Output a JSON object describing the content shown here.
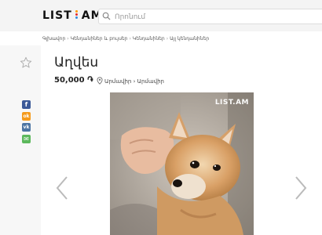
{
  "header": {
    "logo_text_left": "LIST",
    "logo_text_right": "AM",
    "search_placeholder": "Որոնում"
  },
  "breadcrumb": [
    "Գլխավոր",
    "Կենդանիներ և բույսեր",
    "Կենդանիներ",
    "Այլ կենդանիներ"
  ],
  "listing": {
    "title": "Աղվես",
    "price": "50,000 ֏",
    "location": "Արմավիր › Արմավիր"
  },
  "photo": {
    "watermark": "LIST.AM"
  },
  "social": [
    {
      "name": "facebook",
      "glyph": "f",
      "color": "#3b5998"
    },
    {
      "name": "odnoklassniki",
      "glyph": "ok",
      "color": "#f59a1c"
    },
    {
      "name": "vkontakte",
      "glyph": "vk",
      "color": "#4c75a3"
    },
    {
      "name": "email",
      "glyph": "✉",
      "color": "#5cb85c"
    }
  ],
  "colors": {
    "logo_accent_top": "#ff9900",
    "logo_accent_mid": "#e52929",
    "logo_accent_bottom": "#2f8be0"
  }
}
